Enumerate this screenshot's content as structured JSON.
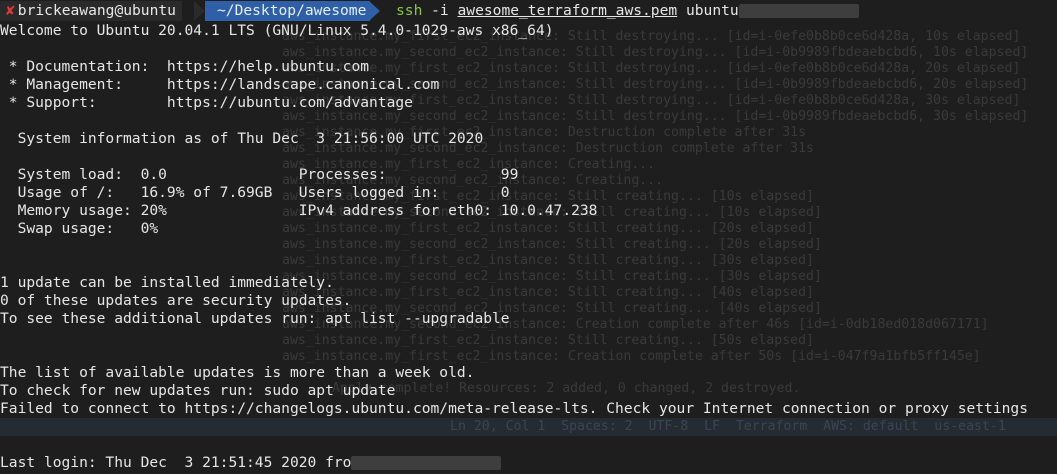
{
  "prompt": {
    "status_icon": "x-mark",
    "user_host": "brickeawang@ubuntu",
    "path": "~/Desktop/awesome",
    "cmd_bin": "ssh",
    "cmd_flag": " -i ",
    "cmd_file": "awesome_terraform_aws.pem",
    "cmd_target": " ubuntu"
  },
  "lines": {
    "welcome": "Welcome to Ubuntu 20.04.1 LTS (GNU/Linux 5.4.0-1029-aws x86_64)",
    "doc": " * Documentation:  https://help.ubuntu.com",
    "mgmt": " * Management:     https://landscape.canonical.com",
    "support": " * Support:        https://ubuntu.com/advantage",
    "sysinfo": "  System information as of Thu Dec  3 21:56:00 UTC 2020",
    "load": "  System load:  0.0               Processes:             99",
    "usage": "  Usage of /:   16.9% of 7.69GB   Users logged in:       0",
    "memory": "  Memory usage: 20%               IPv4 address for eth0: 10.0.47.238",
    "swap": "  Swap usage:   0%",
    "updates1": "1 update can be installed immediately.",
    "updates2": "0 of these updates are security updates.",
    "updates3": "To see these additional updates run: apt list --upgradable",
    "list_old": "The list of available updates is more than a week old.",
    "check_new": "To check for new updates run: sudo apt update",
    "failed": "Failed to connect to https://changelogs.ubuntu.com/meta-release-lts. Check your Internet connection or proxy settings",
    "last_login": "Last login: Thu Dec  3 21:51:45 2020 fro"
  },
  "ghost_lines": [
    "aws_instance.my_first_ec2_instance: Still destroying... [id=i-0efe0b8b0ce6d428a, 10s elapsed]",
    "aws_instance.my_second_ec2_instance: Still destroying... [id=i-0b9989fbdeaebcbd6, 10s elapsed]",
    "aws_instance.my_first_ec2_instance: Still destroying... [id=i-0efe0b8b0ce6d428a, 20s elapsed]",
    "aws_instance.my_second_ec2_instance: Still destroying... [id=i-0b9989fbdeaebcbd6, 20s elapsed]",
    "aws_instance.my_first_ec2_instance: Still destroying... [id=i-0efe0b8b0ce6d428a, 30s elapsed]",
    "aws_instance.my_second_ec2_instance: Still destroying... [id=i-0b9989fbdeaebcbd6, 30s elapsed]",
    "aws_instance.my_first_ec2_instance: Destruction complete after 31s",
    "aws_instance.my_second_ec2_instance: Destruction complete after 31s",
    "aws_instance.my_first_ec2_instance: Creating...",
    "aws_instance.my_second_ec2_instance: Creating...",
    "aws_instance.my_first_ec2_instance: Still creating... [10s elapsed]",
    "aws_instance.my_second_ec2_instance: Still creating... [10s elapsed]",
    "aws_instance.my_first_ec2_instance: Still creating... [20s elapsed]",
    "aws_instance.my_second_ec2_instance: Still creating... [20s elapsed]",
    "aws_instance.my_first_ec2_instance: Still creating... [30s elapsed]",
    "aws_instance.my_second_ec2_instance: Still creating... [30s elapsed]",
    "aws_instance.my_first_ec2_instance: Still creating... [40s elapsed]",
    "aws_instance.my_second_ec2_instance: Still creating... [40s elapsed]",
    "aws_instance.my_second_ec2_instance: Creation complete after 46s [id=i-0db18ed018d067171]",
    "aws_instance.my_first_ec2_instance: Still creating... [50s elapsed]",
    "aws_instance.my_first_ec2_instance: Creation complete after 50s [id=i-047f9a1bfb5ff145e]",
    "",
    "Apply complete! Resources: 2 added, 0 changed, 2 destroyed."
  ],
  "ghost_statusbar": "Ln 20, Col 1  Spaces: 2  UTF-8  LF  Terraform  AWS: default  us-east-1",
  "colors": {
    "background": "#1e1e1e",
    "text": "#e6e6e6",
    "user_segment": "#2a2a2a",
    "path_segment": "#2f5fa6",
    "ssh_command": "#8bc34a",
    "error_mark": "#e53935"
  }
}
